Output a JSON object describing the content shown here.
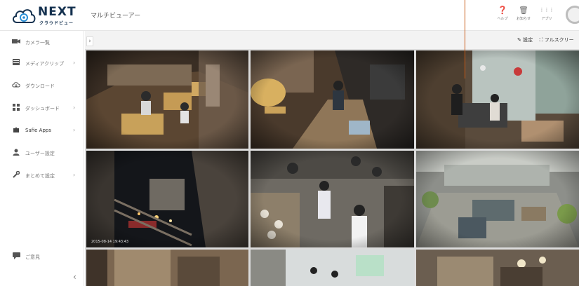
{
  "header": {
    "logo_main": "NEXT",
    "logo_sub": "クラウドビュー",
    "page_title": "マルチビューアー",
    "icons": [
      {
        "name": "help-icon",
        "glyph": "❓",
        "label": "ヘルプ"
      },
      {
        "name": "notice-icon",
        "glyph": "🗑",
        "label": "お知らせ"
      },
      {
        "name": "apps-icon",
        "glyph": "⋮⋮⋮",
        "label": "アプリ"
      }
    ]
  },
  "sidebar": {
    "items": [
      {
        "id": "camera-list",
        "icon": "camera-icon",
        "label": "カメラ一覧",
        "chevron": false,
        "strong": false
      },
      {
        "id": "media-clip",
        "icon": "media-icon",
        "label": "メディアクリップ",
        "chevron": true,
        "strong": false
      },
      {
        "id": "download",
        "icon": "download-icon",
        "label": "ダウンロード",
        "chevron": false,
        "strong": false
      },
      {
        "id": "dashboard",
        "icon": "dashboard-icon",
        "label": "ダッシュボード",
        "chevron": true,
        "strong": false
      },
      {
        "id": "safie-apps",
        "icon": "puzzle-icon",
        "label": "Safie Apps",
        "chevron": true,
        "strong": true
      },
      {
        "id": "user-settings",
        "icon": "user-icon",
        "label": "ユーザー設定",
        "chevron": false,
        "strong": false
      },
      {
        "id": "batch-settings",
        "icon": "wrench-icon",
        "label": "まとめて設定",
        "chevron": true,
        "strong": false
      }
    ],
    "feedback_label": "ご意見",
    "collapse_glyph": "‹",
    "chevron_glyph": "›"
  },
  "content_header": {
    "expand_glyph": "›",
    "settings_label": "✎ 設定",
    "fullscreen_label": "⛶ フルスクリー"
  },
  "grid": {
    "cameras": [
      {
        "id": 1,
        "timestamp": ""
      },
      {
        "id": 2,
        "timestamp": ""
      },
      {
        "id": 3,
        "timestamp": ""
      },
      {
        "id": 4,
        "timestamp": "2015-08-14 19:43:43"
      },
      {
        "id": 5,
        "timestamp": ""
      },
      {
        "id": 6,
        "timestamp": ""
      },
      {
        "id": 7,
        "timestamp": ""
      },
      {
        "id": 8,
        "timestamp": ""
      },
      {
        "id": 9,
        "timestamp": ""
      }
    ]
  },
  "colors": {
    "brand": "#14314f",
    "annotation": "#c85a16",
    "header_bg": "#f3f3f3"
  }
}
